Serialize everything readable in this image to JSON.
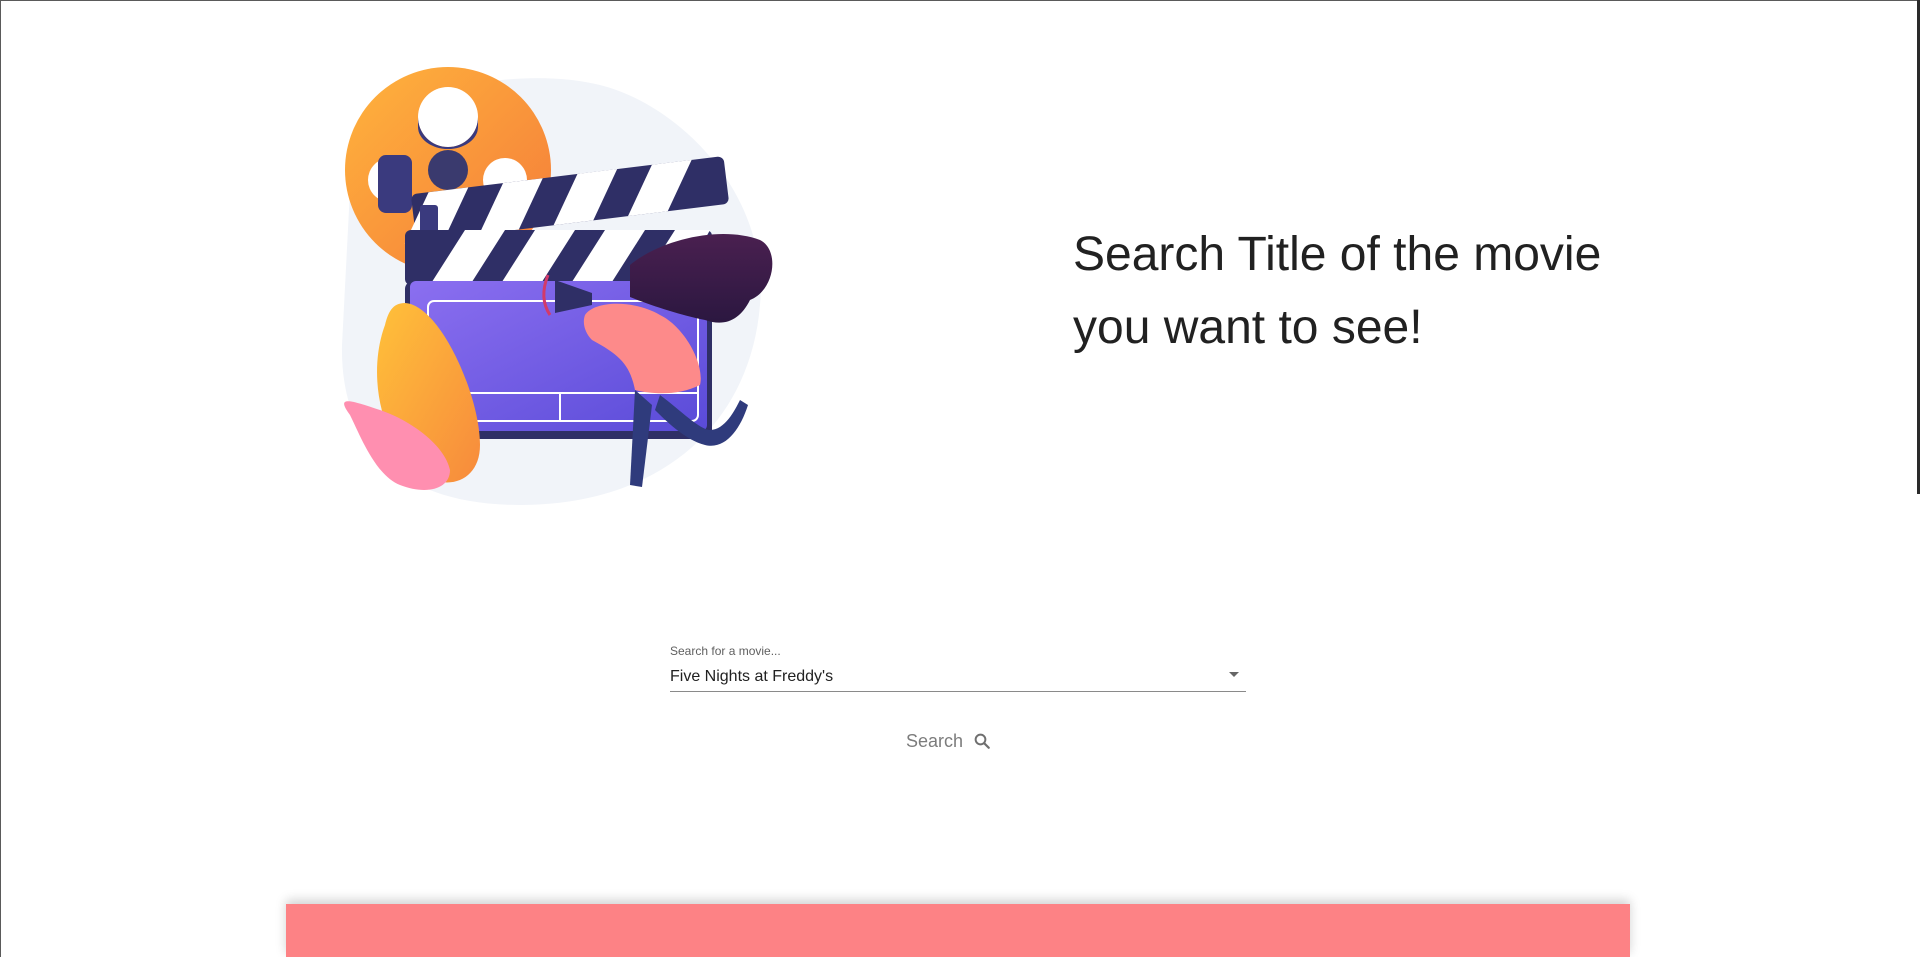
{
  "hero": {
    "headline_line1": "Search Title of the movie",
    "headline_line2": "you want to see!",
    "illustration": "film-clapperboard-illustration"
  },
  "search": {
    "label": "Search for a movie...",
    "value": "Five Nights at Freddy's",
    "button_label": "Search",
    "button_icon": "magnifier-icon",
    "dropdown_icon": "dropdown-arrow-icon"
  },
  "colors": {
    "footer_banner": "#fd8285",
    "headline_text": "#212121",
    "button_text": "#7c7c7c"
  }
}
